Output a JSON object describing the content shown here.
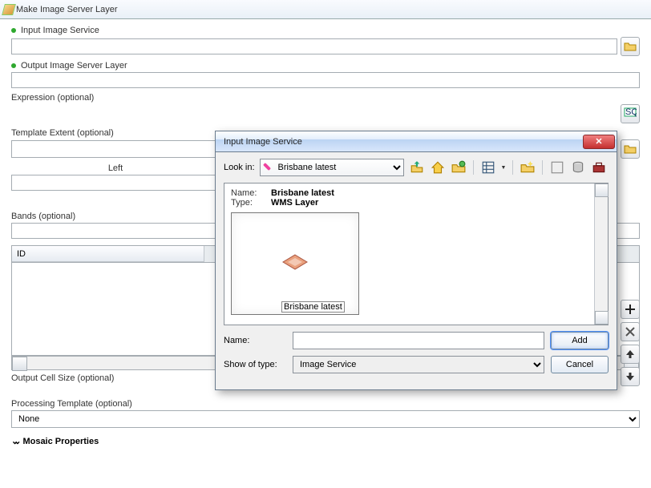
{
  "window": {
    "title": "Make Image Server Layer"
  },
  "labels": {
    "input_image_service": "Input Image Service",
    "output_layer": "Output Image Server Layer",
    "expression": "Expression (optional)",
    "template_extent": "Template Extent (optional)",
    "left": "Left",
    "bands": "Bands (optional)",
    "id": "ID",
    "output_cell": "Output Cell Size (optional)",
    "processing_template": "Processing Template (optional)",
    "mosaic": "Mosaic Properties"
  },
  "values": {
    "input_image_service": "",
    "output_layer": "",
    "template_extent": "",
    "left": "",
    "bands": "",
    "output_cell": "",
    "processing_template": "None"
  },
  "dialog": {
    "title": "Input Image Service",
    "lookin_label": "Look in:",
    "lookin_value": "Brisbane latest",
    "item_name": "Brisbane latest",
    "item_type": "WMS Layer",
    "name_label": "Name:",
    "name_value": "",
    "type_label": "Show of type:",
    "type_value": "Image Service",
    "add": "Add",
    "cancel": "Cancel",
    "kv_name": "Name:",
    "kv_type": "Type:"
  }
}
